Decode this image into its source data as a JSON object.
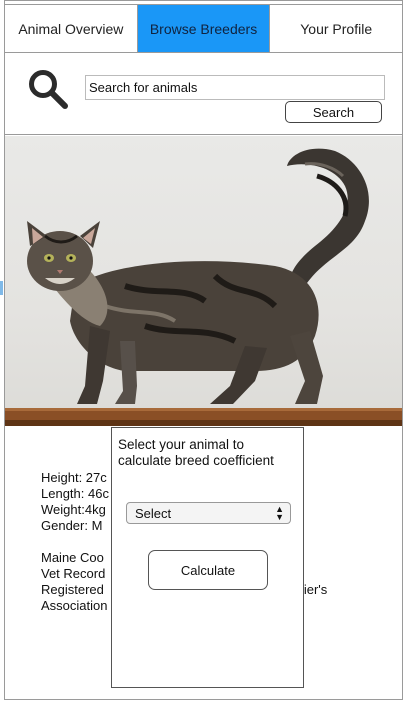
{
  "nav": {
    "tabs": [
      {
        "label": "Animal Overview",
        "active": false
      },
      {
        "label": "Browse Breeders",
        "active": true
      },
      {
        "label": "Your Profile",
        "active": false
      }
    ]
  },
  "search": {
    "placeholder": "Search for animals",
    "button_label": "Search",
    "icon": "search-icon"
  },
  "photo": {
    "subject": "cat-photo"
  },
  "animal_info": {
    "height": "Height: 27c",
    "length": "Length: 46c",
    "weight": "Weight:4kg",
    "gender": "Gender: M",
    "breed": "Maine Coo",
    "vet": "Vet Record",
    "registered": "Registered",
    "registered_suffix": "ancier's",
    "association": "Association"
  },
  "modal": {
    "title": "Select your animal to calculate breed coefficient",
    "select_value": "Select",
    "calculate_label": "Calculate"
  },
  "colors": {
    "accent": "#1a97f7"
  }
}
